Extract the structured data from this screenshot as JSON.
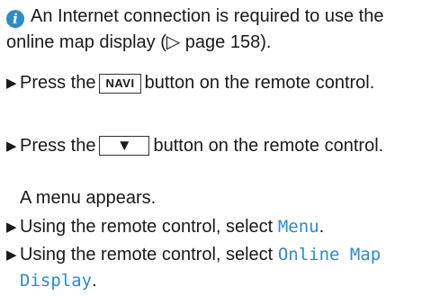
{
  "note": {
    "icon": "info-icon",
    "icon_glyph": "i",
    "icon_color": "#2e8bc9",
    "text": "An Internet connection is required to use the online map display (▷ page 158)."
  },
  "steps": [
    {
      "before": "Press the",
      "key": "NAVI",
      "after": "button on the remote control."
    },
    {
      "before": "Press the",
      "key": "▼",
      "after": "button on the remote control."
    },
    {
      "before": "Using the remote control, select",
      "term": "Menu",
      "after": "."
    },
    {
      "before": "Using the remote control, select",
      "term": "Online Map Display",
      "after": "."
    }
  ],
  "result": "A menu appears.",
  "bullet_glyph": "▶",
  "accent_color": "#2e8bc9"
}
